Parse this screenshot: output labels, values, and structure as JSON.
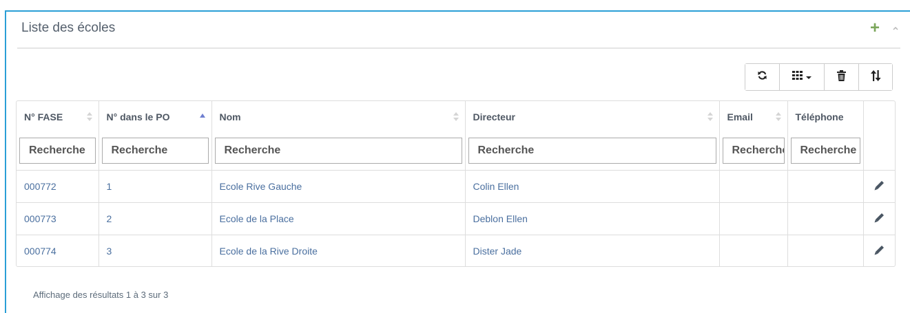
{
  "panel": {
    "title": "Liste des écoles",
    "add_icon": "plus-icon",
    "collapse_icon": "chevron-up-icon"
  },
  "toolbar": {
    "buttons": [
      {
        "name": "refresh",
        "icon": "refresh-icon"
      },
      {
        "name": "columns",
        "icon": "grid-icon"
      },
      {
        "name": "delete",
        "icon": "trash-icon"
      },
      {
        "name": "sort",
        "icon": "sort-icon"
      }
    ]
  },
  "table": {
    "columns": [
      {
        "label": "N° FASE",
        "placeholder": "Recherche",
        "sort": "none"
      },
      {
        "label": "N° dans le PO",
        "placeholder": "Recherche",
        "sort": "asc"
      },
      {
        "label": "Nom",
        "placeholder": "Recherche",
        "sort": "none"
      },
      {
        "label": "Directeur",
        "placeholder": "Recherche",
        "sort": "none"
      },
      {
        "label": "Email",
        "placeholder": "Recherche",
        "sort": "none"
      },
      {
        "label": "Téléphone",
        "placeholder": "Recherche",
        "sort": "none"
      }
    ],
    "rows": [
      {
        "fase": "000772",
        "po": "1",
        "nom": "Ecole Rive Gauche",
        "directeur": "Colin Ellen",
        "email": "",
        "telephone": ""
      },
      {
        "fase": "000773",
        "po": "2",
        "nom": "Ecole de la Place",
        "directeur": "Deblon Ellen",
        "email": "",
        "telephone": ""
      },
      {
        "fase": "000774",
        "po": "3",
        "nom": "Ecole de la Rive Droite",
        "directeur": "Dister Jade",
        "email": "",
        "telephone": ""
      }
    ],
    "row_action_icon": "pencil-icon"
  },
  "footer": {
    "info": "Affichage des résultats 1 à 3 sur 3"
  },
  "colors": {
    "accent": "#2a9fd6",
    "add": "#7ba65b",
    "link": "#4a6f9f",
    "sort_active": "#6f7fd0"
  }
}
